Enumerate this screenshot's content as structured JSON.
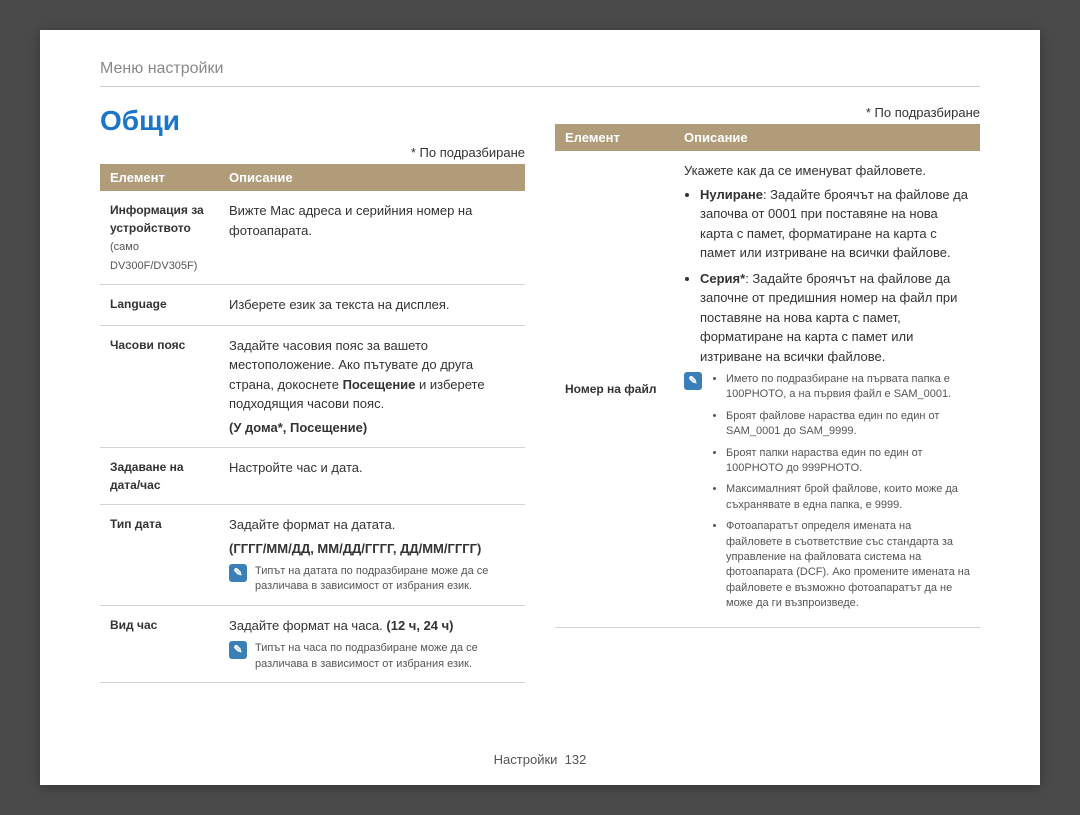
{
  "breadcrumb": "Меню настройки",
  "section_title": "Общи",
  "default_note": "* По подразбиране",
  "note_icon_glyph": "✎",
  "left": {
    "headers": {
      "element": "Елемент",
      "desc": "Описание"
    },
    "rows": [
      {
        "label": "Информация за устройството",
        "sublabel": "(само DV300F/DV305F)",
        "desc": "Вижте Mac адреса и серийния номер на фотоапарата."
      },
      {
        "label": "Language",
        "desc": "Изберете език за текста на дисплея."
      },
      {
        "label": "Часови пояс",
        "desc": "Задайте часовия пояс за вашето местоположение. Ако пътувате до друга страна, докоснете Посещение и изберете подходящия часови пояс.",
        "desc_bold_inline": "Посещение",
        "options": "(У дома*, Посещение)"
      },
      {
        "label": "Задаване на дата/час",
        "desc": "Настройте час и дата."
      },
      {
        "label": "Тип дата",
        "desc": "Задайте формат на датата.",
        "options": "(ГГГГ/ММ/ДД, ММ/ДД/ГГГГ, ДД/ММ/ГГГГ)",
        "note": "Типът на датата по подразбиране може да се различава в зависимост от избрания език."
      },
      {
        "label": "Вид час",
        "desc": "Задайте формат на часа. (12 ч, 24 ч)",
        "desc_bold_tail": "(12 ч, 24 ч)",
        "note": "Типът на часа по подразбиране може да се различава в зависимост от избрания език."
      }
    ]
  },
  "right": {
    "headers": {
      "element": "Елемент",
      "desc": "Описание"
    },
    "row": {
      "label": "Номер на файл",
      "desc_intro": "Укажете как да се именуват файловете.",
      "bullets": [
        {
          "lead": "Нулиране",
          "text": ": Задайте броячът на файлове да започва от 0001 при поставяне на нова карта с памет, форматиране на карта с памет или изтриване на всички файлове."
        },
        {
          "lead": "Серия*",
          "text": ": Задайте броячът на файлове да започне от предишния номер на файл при поставяне на нова карта с памет, форматиране на карта с памет или изтриване на всички файлове."
        }
      ],
      "notes": [
        "Името по подразбиране на първата папка е 100PHOTO, а на първия файл е SAM_0001.",
        "Броят файлове нараства един по един от SAM_0001 до SAM_9999.",
        "Броят папки нараства един по един от 100PHOTO до 999PHOTO.",
        "Максималният брой файлове, които може да съхранявате в една папка, е 9999.",
        "Фотоапаратът определя имената на файловете в съответствие със стандарта за управление на файловата система на фотоапарата (DCF). Ако промените имената на файловете е възможно фотоапаратът да не може да ги възпроизведе."
      ]
    }
  },
  "footer": {
    "label": "Настройки",
    "page": "132"
  }
}
